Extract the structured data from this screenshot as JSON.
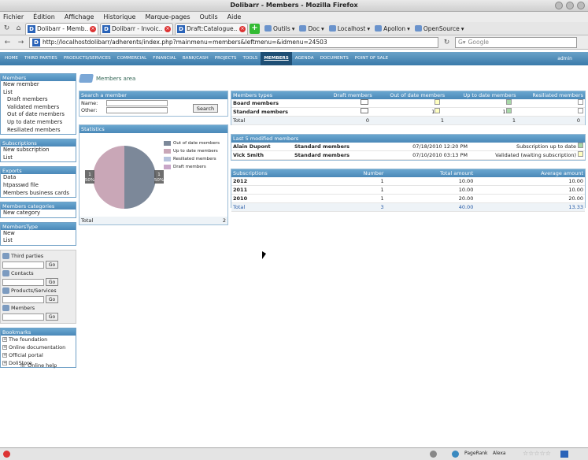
{
  "window": {
    "title": "Dolibarr - Members - Mozilla Firefox"
  },
  "menubar": [
    "Fichier",
    "Édition",
    "Affichage",
    "Historique",
    "Marque-pages",
    "Outils",
    "Aide"
  ],
  "tabs": [
    {
      "label": "Dolibarr - Memb..."
    },
    {
      "label": "Dolibarr - Invoic..."
    },
    {
      "label": "Draft:Catalogue..."
    }
  ],
  "bookmarks": [
    "Outils",
    "Doc",
    "Localhost",
    "Apollon",
    "OpenSource"
  ],
  "url": "http://localhostdolibarr/adherents/index.php?mainmenu=members&leftmenu=&idmenu=24503",
  "search_placeholder": "Google",
  "topnav": [
    "HOME",
    "THIRD PARTIES",
    "PRODUCTS/SERVICES",
    "COMMERCIAL",
    "FINANCIAL",
    "BANK/CASH",
    "PROJECTS",
    "TOOLS",
    "MEMBERS",
    "AGENDA",
    "DOCUMENTS",
    "POINT OF SALE"
  ],
  "user": "admin",
  "sidebar": {
    "members": {
      "head": "Members",
      "items": [
        "New member",
        "List"
      ],
      "sub": [
        "Draft members",
        "Validated members",
        "Out of date members",
        "Up to date members",
        "Resiliated members"
      ]
    },
    "subscriptions": {
      "head": "Subscriptions",
      "items": [
        "New subscription",
        "List"
      ]
    },
    "exports": {
      "head": "Exports",
      "items": [
        "Data",
        "htpasswd file",
        "Members business cards"
      ]
    },
    "categories": {
      "head": "Members categories",
      "items": [
        "New category"
      ]
    },
    "membertype": {
      "head": "MembersType",
      "items": [
        "New",
        "List"
      ]
    },
    "quick": [
      {
        "label": "Third parties",
        "go": "Go"
      },
      {
        "label": "Contacts",
        "go": "Go"
      },
      {
        "label": "Products/Services",
        "go": "Go"
      },
      {
        "label": "Members",
        "go": "Go"
      }
    ],
    "bookmarks": {
      "head": "Bookmarks",
      "items": [
        "The foundation",
        "Online documentation",
        "Official portal",
        "DoliStore"
      ]
    },
    "online_help": "Online help"
  },
  "area_title": "Members area",
  "search_member": {
    "head": "Search a member",
    "name_label": "Name:",
    "other_label": "Other:",
    "button": "Search"
  },
  "statistics": {
    "head": "Statistics",
    "total_label": "Total",
    "total_value": "2"
  },
  "chart_data": {
    "type": "pie",
    "categories": [
      "Out of date members",
      "Up to date members",
      "Resiliated members",
      "Draft members"
    ],
    "values": [
      1,
      1,
      0,
      0
    ],
    "labels": [
      "1\n50%",
      "1\n50%"
    ],
    "colors": [
      "#7c8899",
      "#c9a7b7",
      "#b6c3de",
      "#c8a6c8"
    ]
  },
  "member_types": {
    "headers": [
      "Members types",
      "Draft members",
      "Out of date members",
      "Up to date members",
      "Resiliated members"
    ],
    "rows": [
      {
        "name": "Board members",
        "draft": "",
        "out": "",
        "up": "",
        "res": ""
      },
      {
        "name": "Standard members",
        "draft": "",
        "out": "1",
        "up": "1",
        "res": ""
      }
    ],
    "total": {
      "label": "Total",
      "draft": "0",
      "out": "1",
      "up": "1",
      "res": "0"
    }
  },
  "last_modified": {
    "head": "Last 5 modified members",
    "rows": [
      {
        "name": "Alain Dupont",
        "type": "Standard members",
        "date": "07/18/2010 12:20 PM",
        "status": "Subscription up to date"
      },
      {
        "name": "Vick Smith",
        "type": "Standard members",
        "date": "07/10/2010 03:13 PM",
        "status": "Validated (waiting subscription)"
      }
    ]
  },
  "subscriptions": {
    "headers": [
      "Subscriptions",
      "Number",
      "Total amount",
      "Average amount"
    ],
    "rows": [
      {
        "year": "2012",
        "number": "1",
        "total": "10.00",
        "avg": "10.00"
      },
      {
        "year": "2011",
        "number": "1",
        "total": "10.00",
        "avg": "10.00"
      },
      {
        "year": "2010",
        "number": "1",
        "total": "20.00",
        "avg": "20.00"
      }
    ],
    "total": {
      "label": "Total",
      "number": "3",
      "total": "40.00",
      "avg": "13.33"
    }
  },
  "statusbar": {
    "addon1": "PageRank",
    "addon2": "Alexa"
  }
}
